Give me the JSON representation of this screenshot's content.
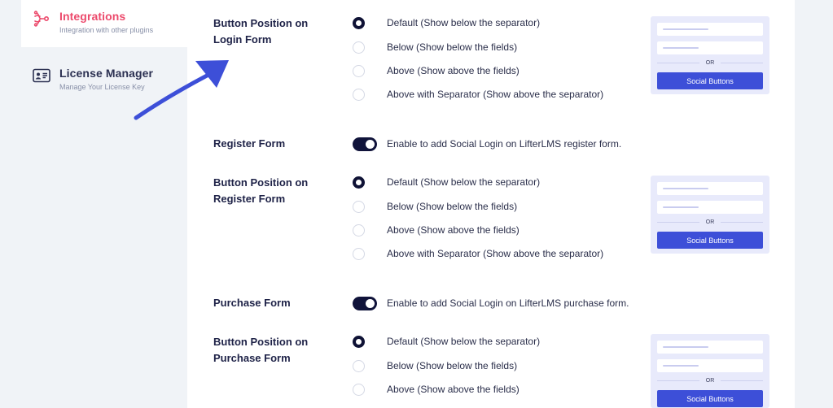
{
  "sidebar": {
    "items": [
      {
        "title": "Integrations",
        "subtitle": "Integration with other plugins",
        "icon": "integrations-icon"
      },
      {
        "title": "License Manager",
        "subtitle": "Manage Your License Key",
        "icon": "license-card-icon"
      }
    ]
  },
  "position_options": [
    "Default (Show below the separator)",
    "Below (Show below the fields)",
    "Above (Show above the fields)",
    "Above with Separator (Show above the separator)"
  ],
  "sections": {
    "login_position": {
      "label": "Button Position on Login Form",
      "selected": 0
    },
    "register_toggle": {
      "label": "Register Form",
      "text": "Enable to add Social Login on LifterLMS register form.",
      "enabled": true
    },
    "register_position": {
      "label": "Button Position on Register Form",
      "selected": 0
    },
    "purchase_toggle": {
      "label": "Purchase Form",
      "text": "Enable to add Social Login on LifterLMS purchase form.",
      "enabled": true
    },
    "purchase_position": {
      "label": "Button Position on Purchase Form",
      "selected": 0
    }
  },
  "preview": {
    "or_text": "OR",
    "button_label": "Social Buttons"
  },
  "colors": {
    "accent": "#ec4a6c",
    "primary": "#3d4fd8",
    "dark": "#10133a",
    "arrow": "#3d4fd8"
  }
}
